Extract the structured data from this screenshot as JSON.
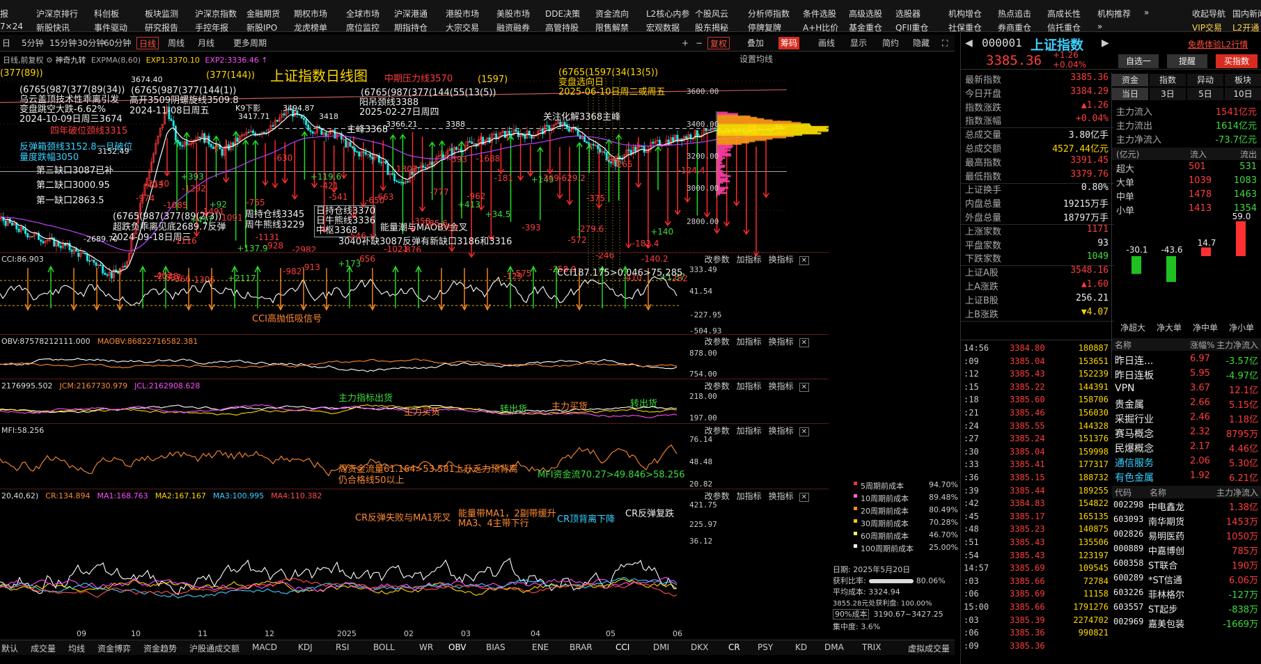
{
  "topnav": {
    "row1": [
      "报",
      "沪深京排行",
      "科创板",
      "板块监测",
      "沪深京指数",
      "金融期货",
      "期权市场",
      "全球市场",
      "沪深港通",
      "港股市场",
      "美股市场",
      "DDE决策",
      "资金流向",
      "L2核心内参",
      "个股风云",
      "分析师指数",
      "条件选股",
      "高级选股",
      "选股器",
      "机构增仓",
      "热点追击",
      "高成长性",
      "机构推荐",
      "»",
      "收起导航",
      "国内新闻"
    ],
    "row2": [
      "7×24",
      "新股快讯",
      "事件驱动",
      "研究报告",
      "手控年报",
      "新股IPO",
      "龙虎榜单",
      "席位监控",
      "期指持仓",
      "大宗交易",
      "融资融券",
      "高管持股",
      "限售解禁",
      "宏观数据",
      "股东揭秘",
      "停牌复牌",
      "A+H比价",
      "基金重仓",
      "QFII重仓",
      "社保重仓",
      "券商重仓",
      "信托重仓",
      "»",
      "VIP交易",
      "L2开通"
    ]
  },
  "toolbar": {
    "periods": [
      "5分钟",
      "15分钟",
      "30分钟",
      "60分钟",
      "日线",
      "周线",
      "月线",
      "更多周期"
    ],
    "right": [
      "+",
      "−",
      "复权",
      "叠加",
      "筹码",
      "画线",
      "显示",
      "简约",
      "隐藏"
    ]
  },
  "legend": {
    "ma_label": "日线,前复权",
    "indicator": "神奇九转",
    "expma": "EXPMA(8,60)",
    "exp1": "EXP1:3370.10",
    "exp2": "EXP2:3336.46",
    "setting": "设置均线"
  },
  "chart_title": "上证指数日线图",
  "main_axis": [
    "3600.00",
    "3400.00",
    "3200.00",
    "3000.00",
    "2800.00"
  ],
  "annotations": [
    {
      "t": "(377(89))",
      "c": "yellow"
    },
    {
      "t": "(6765(987(377(89(34))",
      "c": "white"
    },
    {
      "t": "乌云盖顶技术性乖离引发",
      "c": "white"
    },
    {
      "t": "变盘跳空大跌-6.62%",
      "c": "white"
    },
    {
      "t": "2024-10-09日周三3674",
      "c": "white"
    },
    {
      "t": "四年破位颈线3315",
      "c": "red"
    },
    {
      "t": "反弹箱颈线3152.8一旦破位",
      "c": "cyan"
    },
    {
      "t": "量度跌幅3050",
      "c": "cyan"
    },
    {
      "t": "第三缺口3087已补",
      "c": "white"
    },
    {
      "t": "第二缺口3000.95",
      "c": "white"
    },
    {
      "t": "第一缺口2863.5",
      "c": "white"
    },
    {
      "t": "3674.40",
      "c": "white"
    },
    {
      "t": "(6765(987(377(144(1))",
      "c": "white"
    },
    {
      "t": "高开3509阴螺旋线3509.8",
      "c": "white"
    },
    {
      "t": "2024-11-08日周五",
      "c": "white"
    },
    {
      "t": "(377(144))",
      "c": "yellow"
    },
    {
      "t": "中期压力线3570",
      "c": "red"
    },
    {
      "t": "(1597)",
      "c": "yellow"
    },
    {
      "t": "(6765(1597(34(13(5))",
      "c": "yellow"
    },
    {
      "t": "变盘选向日",
      "c": "yellow"
    },
    {
      "t": "2025-06-10日周二或周五",
      "c": "yellow"
    },
    {
      "t": "(6765(987(377(144(55(13(5))",
      "c": "white"
    },
    {
      "t": "阳吊颈线3388",
      "c": "white"
    },
    {
      "t": "2025-02-27日周四",
      "c": "white"
    },
    {
      "t": "3494.87",
      "c": "white"
    },
    {
      "t": "K9下影",
      "c": "white"
    },
    {
      "t": "3417.71",
      "c": "white"
    },
    {
      "t": "3418",
      "c": "white"
    },
    {
      "t": "主峰3368",
      "c": "white"
    },
    {
      "t": "3366.21",
      "c": "white"
    },
    {
      "t": "3388",
      "c": "white"
    },
    {
      "t": "关注化解3368主峰",
      "c": "white"
    },
    {
      "t": "(6765(987(377(89(2(3))",
      "c": "white"
    },
    {
      "t": "超跌负乖离见底2689.7反弹",
      "c": "white"
    },
    {
      "t": "2024-09-18日周三",
      "c": "white"
    },
    {
      "t": "周持仓线3345",
      "c": "white"
    },
    {
      "t": "周牛熊线3229",
      "c": "white"
    },
    {
      "t": "日持仓线3370",
      "c": "white"
    },
    {
      "t": "日牛熊线3336",
      "c": "white"
    },
    {
      "t": "中枢3368",
      "c": "white"
    },
    {
      "t": "能量潮与MAOBV金叉",
      "c": "white"
    },
    {
      "t": "3040补缺3087反弹有新缺口3186和3316",
      "c": "white"
    },
    {
      "t": "3152.49",
      "c": "white"
    },
    {
      "t": "-2689.70",
      "c": "white"
    }
  ],
  "bar_labels": [
    "-974",
    "-2140",
    "-2148",
    "-1085",
    "-1116",
    "-1292",
    "-1306",
    "-1491",
    "+92",
    "-1091",
    "+2117",
    "+137.9",
    "-755",
    "-1131",
    "-928",
    "-630",
    "-982",
    "-2982",
    "-913",
    "+119.6",
    "-421",
    "-541",
    "+173",
    "-546",
    "-656",
    "-650",
    "-663",
    "-1021",
    "-1307",
    "-876",
    "-358",
    "-185.6",
    "-777",
    "-353",
    "-393",
    "+413",
    "-962",
    "-1688",
    "+34.5",
    "-181",
    "-129",
    "-575",
    "-393",
    "+143",
    "-369",
    "-258.9",
    "-629.2",
    "-572",
    "-279.6",
    "-375",
    "-246",
    "-96",
    "-265",
    "-410",
    "-182.4",
    "-140.2",
    "+140",
    "+1.37",
    "-282",
    "-124.4",
    "-403",
    "-462",
    "-537",
    "-366",
    "+393",
    "+417"
  ],
  "panels": [
    {
      "name": "cci",
      "head": "CCI:86.903",
      "axis": [
        "333.49",
        "41.54",
        "-227.95",
        "-504.93"
      ],
      "notes": [
        "CCI187.175>0.046>75.285",
        "CCI高抛低吸信号"
      ]
    },
    {
      "name": "obv",
      "head": "OBV:87578212111.000",
      "head2": "MAOBV:86822716582.381",
      "axis": [
        "878.00",
        "754.00"
      ],
      "notes": []
    },
    {
      "name": "jcm",
      "head": "2176995.502",
      "head2": "JCM:2167730.979",
      "head3": "JCL:2162908.628",
      "axis": [
        "218.00",
        "197.00"
      ],
      "notes": [
        "主力指标出货",
        "主力买货",
        "转出货",
        "主力买货",
        "转出货"
      ]
    },
    {
      "name": "mfi",
      "head": "MFI:58.256",
      "axis": [
        "76.14",
        "48.48",
        "20.82"
      ],
      "notes": [
        "周资金流量61.164>53.581上升乏力顶背离",
        "仍合格线50以上",
        "MFI资金流70.27>49.846>58.256"
      ]
    },
    {
      "name": "cr",
      "head": "20,40,62)",
      "head2": "CR:134.894",
      "head3": "MA1:168.763",
      "head4": "MA2:167.167",
      "head5": "MA3:100.995",
      "head6": "MA4:110.382",
      "axis": [
        "421.75",
        "225.97",
        "36.12"
      ],
      "notes": [
        "CR反弹失败与MA1死叉",
        "能量带MA1，2副带缓升",
        "MA3、4主带下行",
        "CR顶背离下降",
        "CR反弹复跌"
      ]
    }
  ],
  "panel_tools": [
    "改参数",
    "加指标",
    "换指标"
  ],
  "time_labels": [
    "09",
    "10",
    "11",
    "12",
    "2025",
    "02",
    "03",
    "04",
    "05",
    "06"
  ],
  "cost": {
    "rows": [
      [
        "5周期前成本",
        "94.70%",
        "#ff3333"
      ],
      [
        "10周期前成本",
        "89.48%",
        "#ff66cc"
      ],
      [
        "20周期前成本",
        "80.49%",
        "#ff8c1a"
      ],
      [
        "30周期前成本",
        "70.28%",
        "#ffcc00"
      ],
      [
        "60周期前成本",
        "46.70%",
        "#ffee66"
      ],
      [
        "100周期前成本",
        "25.00%",
        "#ffffff"
      ]
    ],
    "date": "日期: 2025年5月20日",
    "profit_label": "获利比率:",
    "profit": "80.06%",
    "avg": "平均成本: 3324.94",
    "range": "3855.28元处获利盘: 100.00%",
    "cost_sel": "90%成本",
    "cost_range": "3190.67~3427.25",
    "conc": "集中度: 3.6%"
  },
  "right": {
    "code": "000001",
    "name": "上证指数",
    "price": "3385.36",
    "chg": "+1.26",
    "pct": "+0.04%",
    "free": "免费体验L2行情",
    "btn_self": "自选一",
    "btn_alert": "提醒",
    "btn_buy": "买指数",
    "stats": [
      [
        "最新指数",
        "3385.36",
        "red"
      ],
      [
        "今日开盘",
        "3384.29",
        "red"
      ],
      [
        "指数涨跌",
        "▲1.26",
        "red"
      ],
      [
        "指数涨幅",
        "+0.04%",
        "red"
      ],
      [
        "总成交量",
        "3.80亿手",
        "white"
      ],
      [
        "总成交额",
        "4527.44亿元",
        "yellow"
      ],
      [
        "最高指数",
        "3391.45",
        "red"
      ],
      [
        "最低指数",
        "3379.76",
        "red"
      ],
      [
        "上证换手",
        "0.80%",
        "white"
      ],
      [
        "内盘总量",
        "19215万手",
        "white"
      ],
      [
        "外盘总量",
        "18797万手",
        "white"
      ],
      [
        "上涨家数",
        "1171",
        "red"
      ],
      [
        "平盘家数",
        "93",
        "white"
      ],
      [
        "下跌家数",
        "1049",
        "green"
      ],
      [
        "上证A股",
        "3548.16",
        "red"
      ],
      [
        "上A涨跌",
        "▲1.60",
        "red"
      ],
      [
        "上证B股",
        "256.21",
        "white"
      ],
      [
        "上B涨跌",
        "▼4.07",
        "yellow"
      ]
    ],
    "tabs1": [
      "资金",
      "指数",
      "异动",
      "板块"
    ],
    "tabs2": [
      "当日",
      "3日",
      "5日",
      "10日"
    ],
    "flow": [
      [
        "主力流入",
        "1541亿元",
        "red"
      ],
      [
        "主力流出",
        "1614亿元",
        "green"
      ],
      [
        "主力净流入",
        "-73.7亿元",
        "green"
      ]
    ],
    "flowhead": [
      "(亿元)",
      "流入",
      "流出"
    ],
    "sizes": [
      [
        "超大",
        "501",
        "531"
      ],
      [
        "大单",
        "1039",
        "1083"
      ],
      [
        "中单",
        "1478",
        "1463"
      ],
      [
        "小单",
        "1413",
        "1354"
      ]
    ],
    "bars": [
      {
        "v": "-30.1",
        "val": -30.1
      },
      {
        "v": "-43.6",
        "val": -43.6
      },
      {
        "v": "14.7",
        "val": 14.7
      },
      {
        "v": "59.0",
        "val": 59.0
      }
    ],
    "barlabels": [
      "净超大",
      "净大单",
      "净中单",
      "净小单"
    ],
    "ticks": [
      [
        "14:56",
        "3384.80",
        "180887"
      ],
      [
        ":09",
        "3385.04",
        "153651"
      ],
      [
        ":12",
        "3385.43",
        "152239"
      ],
      [
        ":15",
        "3385.22",
        "144391"
      ],
      [
        ":18",
        "3385.60",
        "158706"
      ],
      [
        ":21",
        "3385.46",
        "156030"
      ],
      [
        ":24",
        "3385.55",
        "144328"
      ],
      [
        ":27",
        "3385.24",
        "151376"
      ],
      [
        ":30",
        "3385.04",
        "159998"
      ],
      [
        ":33",
        "3385.41",
        "177317"
      ],
      [
        ":36",
        "3385.15",
        "188732"
      ],
      [
        ":39",
        "3385.44",
        "189255"
      ],
      [
        ":42",
        "3384.83",
        "154822"
      ],
      [
        ":45",
        "3385.17",
        "165135"
      ],
      [
        ":48",
        "3385.23",
        "140875"
      ],
      [
        ":51",
        "3385.43",
        "135506"
      ],
      [
        ":54",
        "3385.43",
        "123197"
      ],
      [
        "14:57",
        "3385.69",
        "109545"
      ],
      [
        ":03",
        "3385.66",
        "72784"
      ],
      [
        ":06",
        "3385.69",
        "11158"
      ],
      [
        "15:00",
        "3385.66",
        "1791276"
      ],
      [
        ":03",
        "3385.39",
        "2274702"
      ],
      [
        ":06",
        "3385.36",
        "990821"
      ],
      [
        ":09",
        "3385.36",
        ""
      ]
    ],
    "secthead": [
      "名称",
      "涨幅%",
      "主力净流入"
    ],
    "sectors": [
      [
        "昨日连...",
        "6.97",
        "-3.57亿"
      ],
      [
        "昨日连板",
        "5.95",
        "-4.97亿"
      ],
      [
        "VPN",
        "3.67",
        "12.1亿"
      ],
      [
        "贵金属",
        "2.66",
        "5.15亿"
      ],
      [
        "采掘行业",
        "2.46",
        "1.18亿"
      ],
      [
        "赛马概念",
        "2.32",
        "8795万"
      ],
      [
        "民爆概念",
        "2.17",
        "4.46亿"
      ],
      [
        "通信服务",
        "2.06",
        "5.30亿"
      ],
      [
        "有色金属",
        "1.92",
        "6.21亿"
      ]
    ],
    "stockhead": [
      "代码",
      "名称",
      "主力净流入"
    ],
    "stocks": [
      [
        "002298",
        "中电鑫龙",
        "1.38亿",
        "red"
      ],
      [
        "603093",
        "南华期货",
        "1453万",
        "red"
      ],
      [
        "002826",
        "易明医药",
        "1050万",
        "red"
      ],
      [
        "000889",
        "中嘉博创",
        "785万",
        "red"
      ],
      [
        "600358",
        "ST联合",
        "190万",
        "red"
      ],
      [
        "600289",
        "*ST信通",
        "6.06万",
        "red"
      ],
      [
        "603226",
        "菲林格尔",
        "-127万",
        "green"
      ],
      [
        "603557",
        "ST起步",
        "-838万",
        "green"
      ],
      [
        "002969",
        "嘉美包装",
        "-1669万",
        "green"
      ]
    ]
  },
  "bottombar": [
    "默认",
    "成交量",
    "均线",
    "资金博弈",
    "资金趋势",
    "沪股通成交额",
    "MACD",
    "KDJ",
    "RSI",
    "BOLL",
    "WR",
    "OBV",
    "BIAS",
    "ENE",
    "BRAR",
    "CCI",
    "DMI",
    "DKX",
    "CR",
    "PSY",
    "KD",
    "DMA",
    "TRIX",
    "虚拟成交量",
    "神奇九转",
    "更多指标",
    "模板"
  ]
}
